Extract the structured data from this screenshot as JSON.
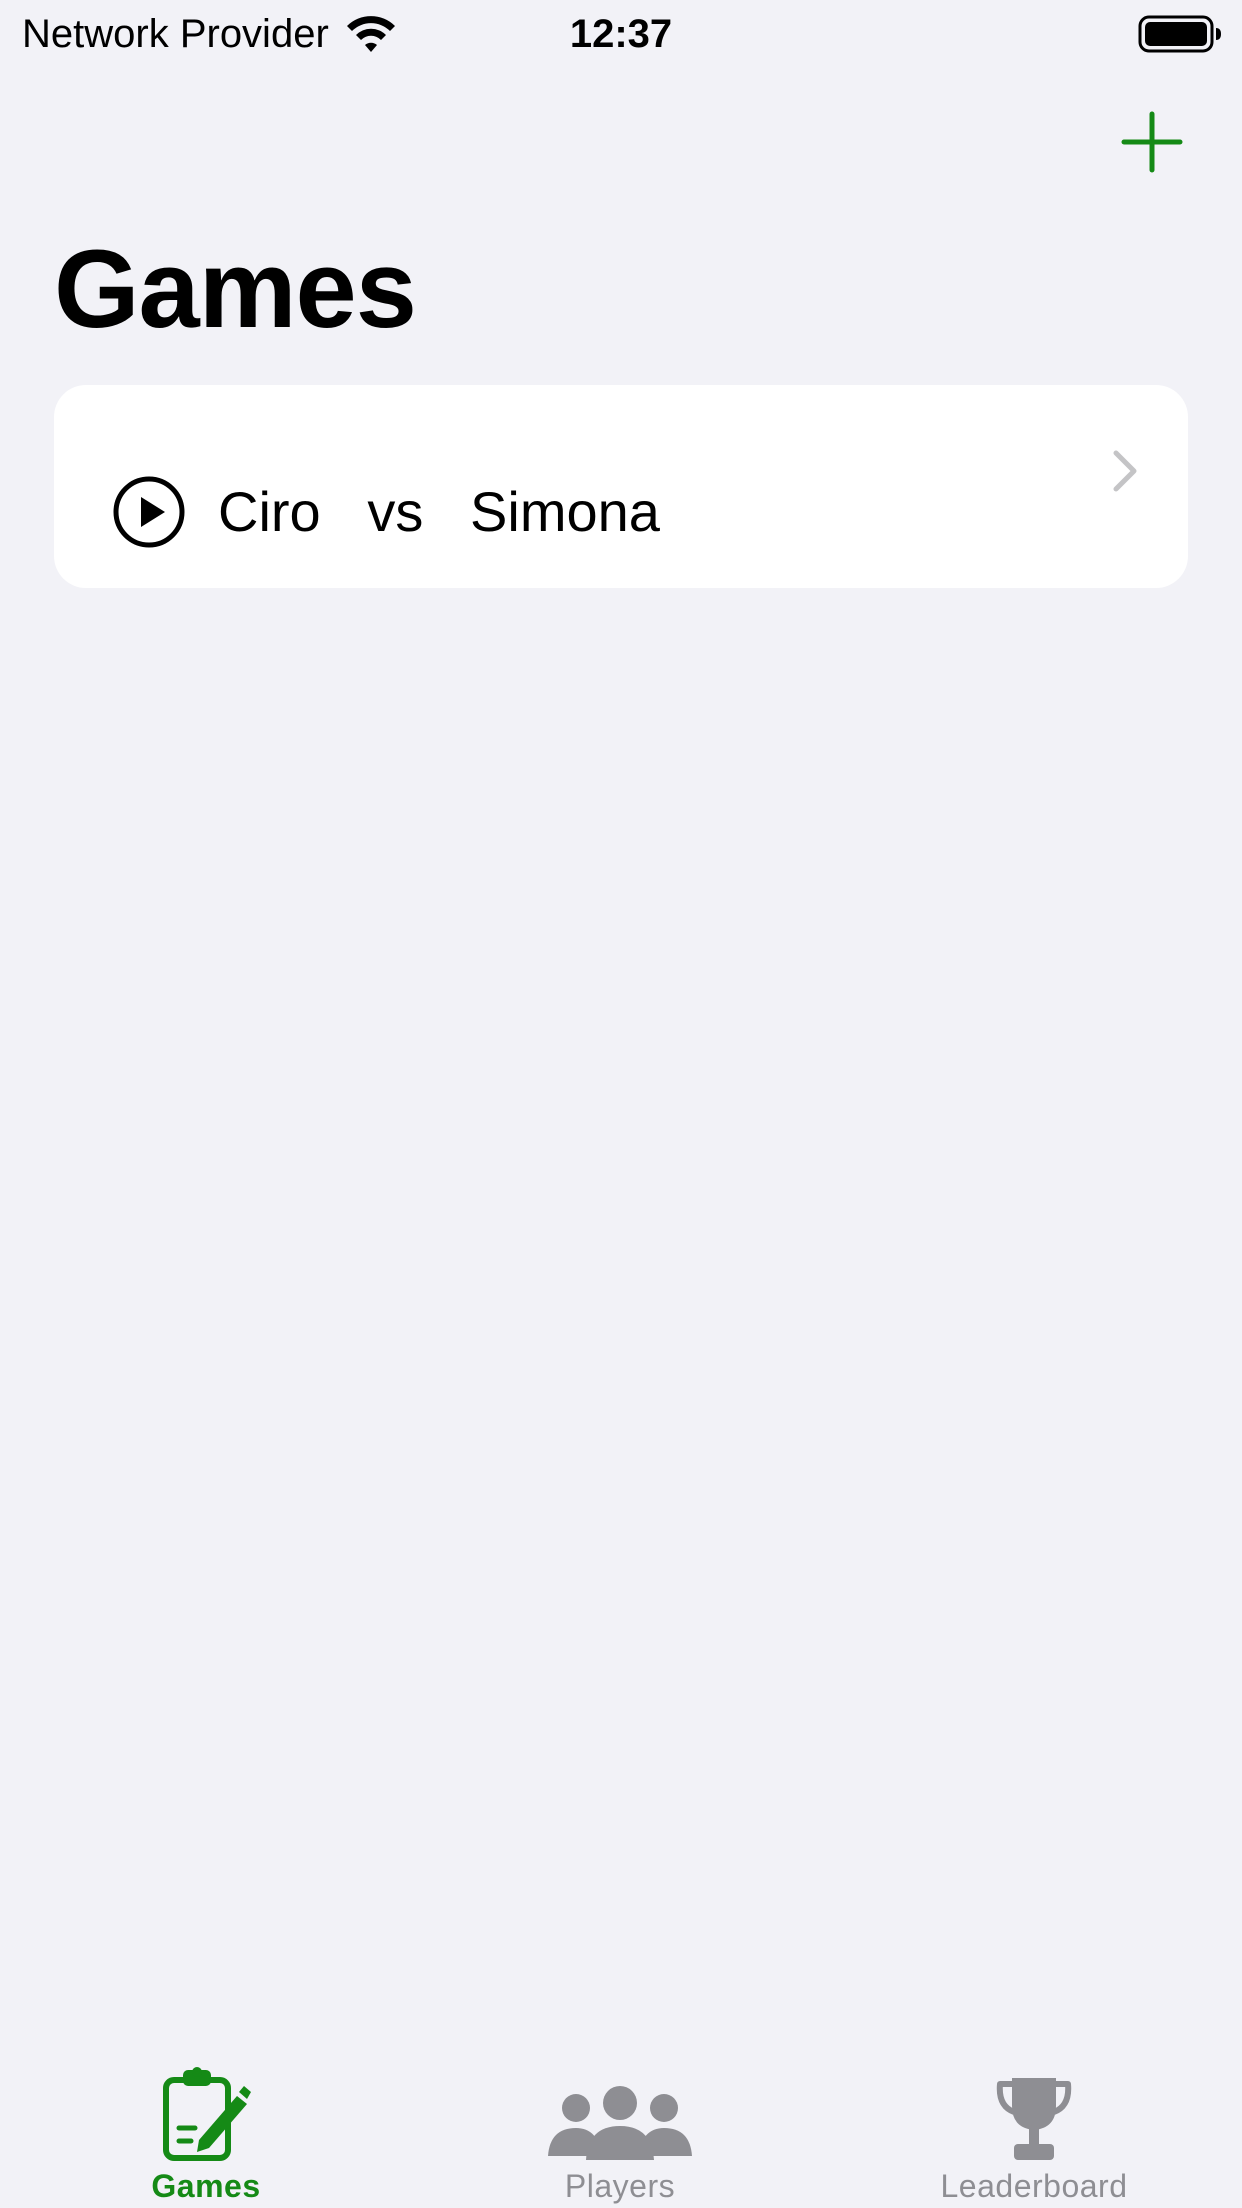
{
  "status_bar": {
    "carrier": "Network Provider",
    "time": "12:37",
    "icons": [
      "wifi-icon",
      "battery-icon"
    ]
  },
  "nav": {
    "add_icon": "plus-icon",
    "title": "Games"
  },
  "games": [
    {
      "title": "Ciro   vs   Simona",
      "icon": "play-circle-icon",
      "accessory": "chevron-right-icon"
    }
  ],
  "tab_bar": {
    "selected": "Games",
    "tabs": [
      {
        "label": "Games",
        "icon": "clipboard-edit-icon"
      },
      {
        "label": "Players",
        "icon": "people-icon"
      },
      {
        "label": "Leaderboard",
        "icon": "trophy-icon"
      }
    ]
  },
  "colors": {
    "accent": "#158a16",
    "background": "#f2f2f7",
    "card": "#ffffff",
    "inactive_tab": "#8e8e93",
    "chevron": "#c4c4c6"
  }
}
